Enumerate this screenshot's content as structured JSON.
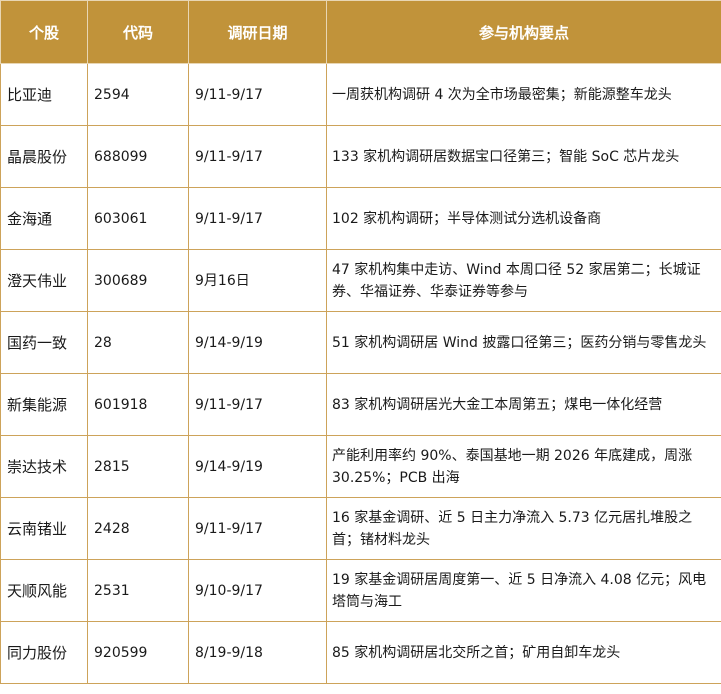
{
  "table": {
    "headers": [
      "个股",
      "代码",
      "调研日期",
      "参与机构要点"
    ],
    "rows": [
      {
        "name": "比亚迪",
        "code": "2594",
        "date": "9/11-9/17",
        "note": "一周获机构调研 4 次为全市场最密集；新能源整车龙头"
      },
      {
        "name": "晶晨股份",
        "code": "688099",
        "date": "9/11-9/17",
        "note": "133 家机构调研居数据宝口径第三；智能 SoC 芯片龙头"
      },
      {
        "name": "金海通",
        "code": "603061",
        "date": "9/11-9/17",
        "note": "102 家机构调研；半导体测试分选机设备商"
      },
      {
        "name": "澄天伟业",
        "code": "300689",
        "date": "9月16日",
        "note": "47 家机构集中走访、Wind 本周口径 52 家居第二；长城证券、华福证券、华泰证券等参与"
      },
      {
        "name": "国药一致",
        "code": "28",
        "date": "9/14-9/19",
        "note": "51 家机构调研居 Wind 披露口径第三；医药分销与零售龙头"
      },
      {
        "name": "新集能源",
        "code": "601918",
        "date": "9/11-9/17",
        "note": "83 家机构调研居光大金工本周第五；煤电一体化经营"
      },
      {
        "name": "崇达技术",
        "code": "2815",
        "date": "9/14-9/19",
        "note": "产能利用率约 90%、泰国基地一期 2026 年底建成，周涨 30.25%；PCB 出海"
      },
      {
        "name": "云南锗业",
        "code": "2428",
        "date": "9/11-9/17",
        "note": "16 家基金调研、近 5 日主力净流入 5.73 亿元居扎堆股之首；锗材料龙头"
      },
      {
        "name": "天顺风能",
        "code": "2531",
        "date": "9/10-9/17",
        "note": "19 家基金调研居周度第一、近 5 日净流入 4.08 亿元；风电塔筒与海工"
      },
      {
        "name": "同力股份",
        "code": "920599",
        "date": "8/19-9/18",
        "note": "85 家机构调研居北交所之首；矿用自卸车龙头"
      }
    ]
  }
}
